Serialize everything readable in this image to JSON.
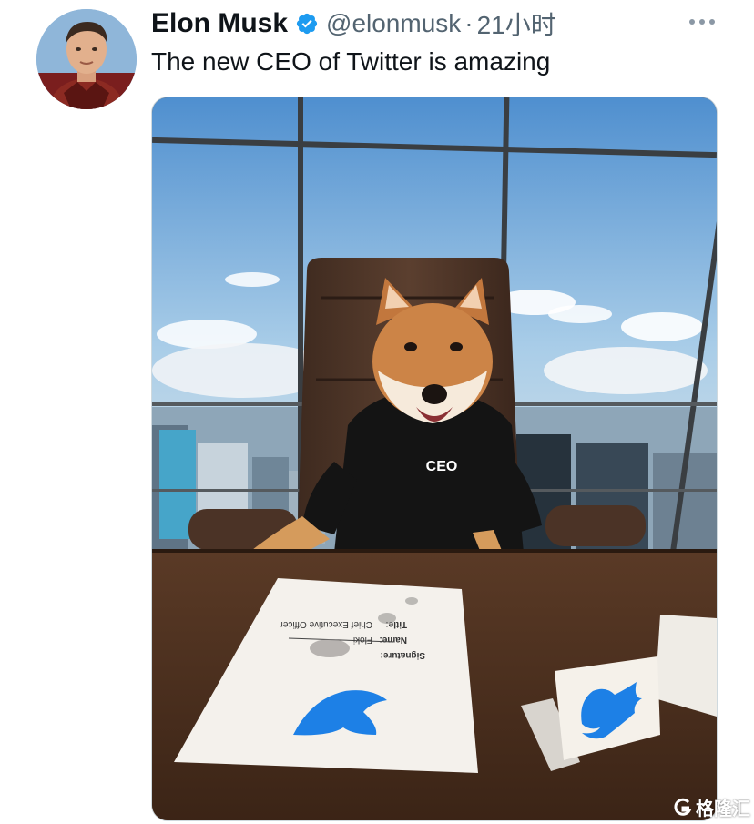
{
  "tweet": {
    "author_name": "Elon Musk",
    "handle": "@elonmusk",
    "separator": "·",
    "time": "21小时",
    "text": "The new CEO of Twitter is amazing",
    "verified": true
  },
  "media": {
    "sweater_text": "CEO",
    "document_lines": [
      "Signature:",
      "Name:",
      "Floki",
      "Title:",
      "Chief Executive Officer"
    ]
  },
  "watermark": {
    "text": "格隆汇"
  },
  "icons": {
    "verified": "verified-badge-icon",
    "more": "more-options-icon",
    "brand": "twitter-bird-icon"
  },
  "colors": {
    "verified": "#1d9bf0",
    "twitter_blue": "#1d9bf0",
    "handle_gray": "#536471"
  }
}
